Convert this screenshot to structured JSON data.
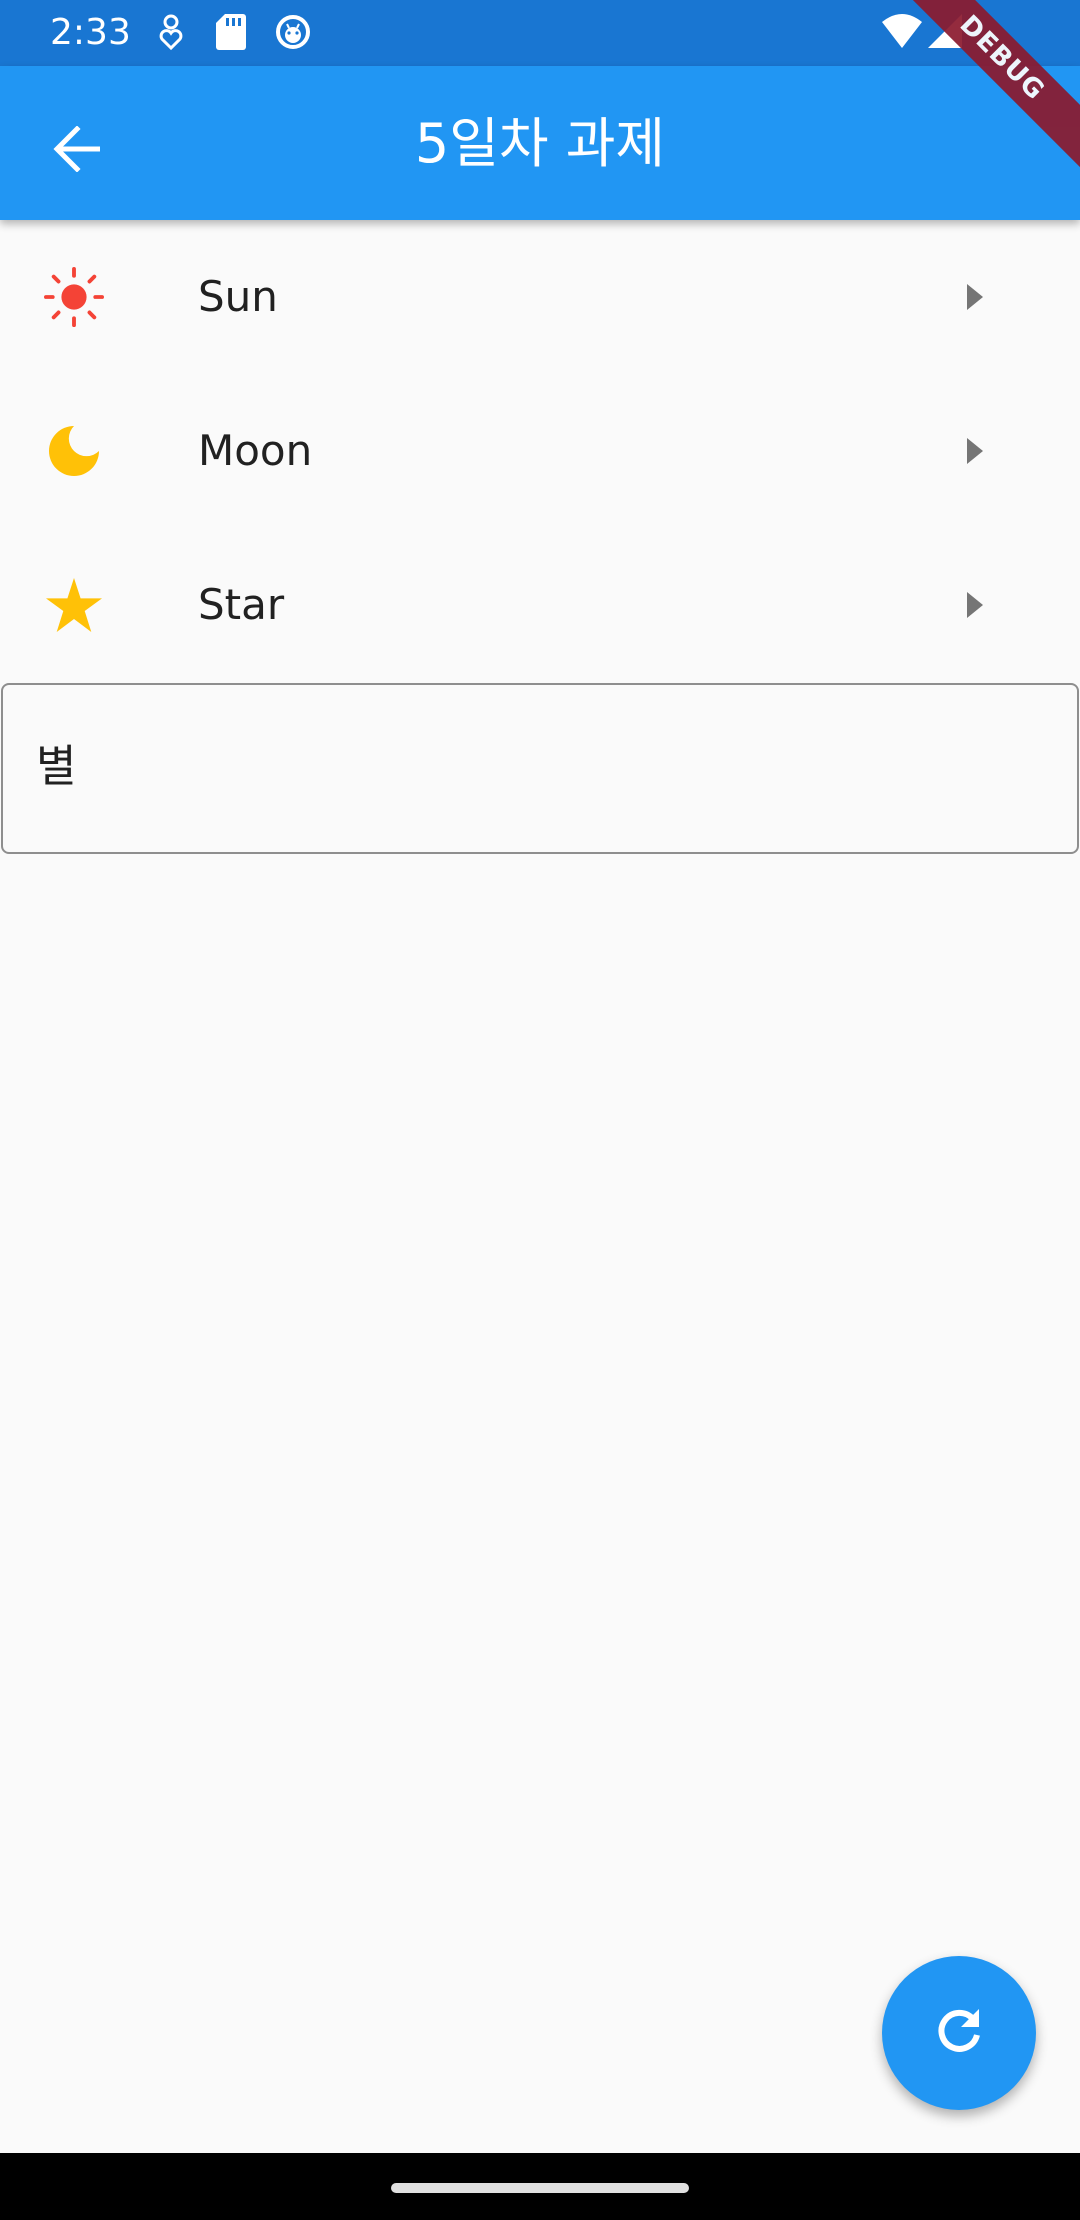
{
  "status_bar": {
    "time": "2:33",
    "icons_left": [
      "location-heart-icon",
      "sd-card-icon",
      "android-debug-icon"
    ],
    "icons_right": [
      "wifi-icon",
      "signal-icon"
    ]
  },
  "app_bar": {
    "title": "5일차 과제",
    "back_icon": "arrow-back-icon"
  },
  "debug_banner": "DEBUG",
  "list": {
    "items": [
      {
        "label": "Sun",
        "icon": "sun-icon",
        "icon_color": "#f44336"
      },
      {
        "label": "Moon",
        "icon": "moon-icon",
        "icon_color": "#ffc107"
      },
      {
        "label": "Star",
        "icon": "star-icon",
        "icon_color": "#ffc107"
      }
    ],
    "trailing_icon": "arrow-right-icon"
  },
  "text_field": {
    "value": "별"
  },
  "fab": {
    "icon": "refresh-icon",
    "color": "#2196f3"
  },
  "colors": {
    "primary": "#2196f3",
    "primary_dark": "#1976d2",
    "background": "#fafafa"
  }
}
